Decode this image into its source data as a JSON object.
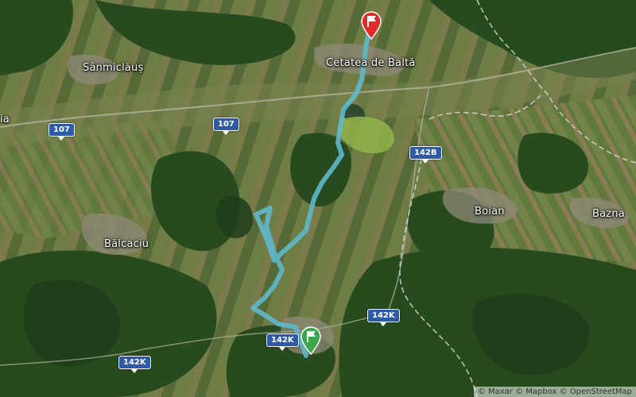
{
  "places": [
    {
      "name": "Sânmiclăuș"
    },
    {
      "name": "Cetatea de Baltă"
    },
    {
      "name": "Boian"
    },
    {
      "name": "Bazna"
    },
    {
      "name": "Bălcaciu"
    },
    {
      "name": "ia"
    }
  ],
  "road_shields": [
    "107",
    "107",
    "142B",
    "142K",
    "142K",
    "142K"
  ],
  "route": {
    "color": "#5fb8cc",
    "start_marker": {
      "icon": "flag-icon",
      "color": "#3aa84a"
    },
    "end_marker": {
      "icon": "flag-icon",
      "color": "#e02b2b"
    }
  },
  "attribution": "© Maxar © Mapbox © OpenStreetMap"
}
